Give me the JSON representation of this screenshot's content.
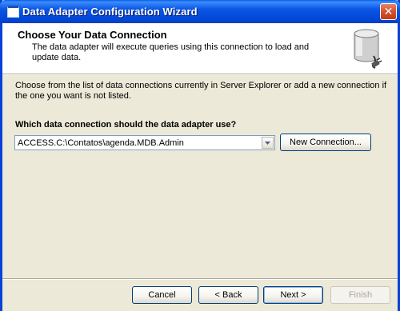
{
  "window": {
    "title": "Data Adapter Configuration Wizard",
    "close_glyph": "✕"
  },
  "header": {
    "title": "Choose Your Data Connection",
    "description": "The data adapter will execute queries using this connection to load and update data."
  },
  "content": {
    "instructions": "Choose from the list of data connections currently in Server Explorer or add a new connection if the one you want is not listed.",
    "question": "Which data connection should the data adapter use?",
    "connection_select": {
      "value": "ACCESS.C:\\Contatos\\agenda.MDB.Admin"
    },
    "new_connection_label": "New Connection..."
  },
  "footer": {
    "cancel_label": "Cancel",
    "back_label": "< Back",
    "next_label": "Next >",
    "finish_label": "Finish"
  },
  "icons": {
    "window": "window-icon",
    "database": "database-plug-icon",
    "dropdown": "chevron-down-icon",
    "close": "close-icon"
  }
}
